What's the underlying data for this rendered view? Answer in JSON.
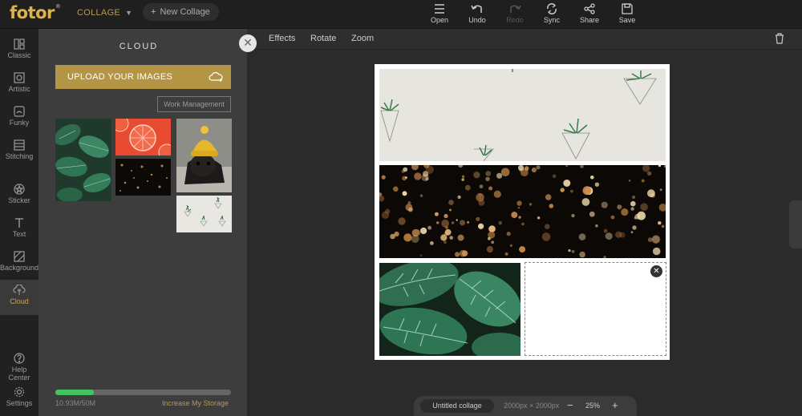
{
  "app": {
    "logo": "fotor",
    "logo_mark": "®",
    "mode": "COLLAGE",
    "new_collage": "New Collage"
  },
  "toolbar": [
    {
      "label": "Open",
      "icon": "menu-icon",
      "enabled": true
    },
    {
      "label": "Undo",
      "icon": "undo-icon",
      "enabled": true
    },
    {
      "label": "Redo",
      "icon": "redo-icon",
      "enabled": false
    },
    {
      "label": "Sync",
      "icon": "sync-icon",
      "enabled": true
    },
    {
      "label": "Share",
      "icon": "share-icon",
      "enabled": true
    },
    {
      "label": "Save",
      "icon": "save-icon",
      "enabled": true
    }
  ],
  "sidebar": {
    "items": [
      {
        "label": "Classic",
        "icon": "grid-icon",
        "active": false
      },
      {
        "label": "Artistic",
        "icon": "artistic-icon",
        "active": false
      },
      {
        "label": "Funky",
        "icon": "funky-icon",
        "active": false
      },
      {
        "label": "Stitching",
        "icon": "stitching-icon",
        "active": false
      },
      {
        "label": "Sticker",
        "icon": "sticker-icon",
        "active": false
      },
      {
        "label": "Text",
        "icon": "text-icon",
        "active": false
      },
      {
        "label": "Background",
        "icon": "background-icon",
        "active": false
      },
      {
        "label": "Cloud",
        "icon": "cloud-icon",
        "active": true
      }
    ],
    "bottom": [
      {
        "label": "Help Center",
        "icon": "help-icon"
      },
      {
        "label": "Settings",
        "icon": "settings-icon"
      }
    ]
  },
  "panel": {
    "title": "CLOUD",
    "upload_label": "UPLOAD YOUR IMAGES",
    "work_management": "Work Management",
    "thumbnails": [
      "green-leaves-thumb",
      "grapefruit-thumb",
      "bokeh-thumb",
      "pug-thumb",
      "air-plants-thumb"
    ],
    "storage": {
      "used": "10.93M/50M",
      "fraction": 0.2186,
      "link": "Increase My Storage"
    }
  },
  "editbar": {
    "effects": "Effects",
    "rotate": "Rotate",
    "zoom": "Zoom"
  },
  "bottom": {
    "project_name": "Untitled collage",
    "dimensions": "2000px × 2000px",
    "zoom": "25%",
    "minus": "−",
    "plus": "+"
  },
  "colors": {
    "accent": "#b39545",
    "progress": "#43c35e",
    "panel": "#3d3d3d",
    "topbar": "#1f1f1f"
  }
}
